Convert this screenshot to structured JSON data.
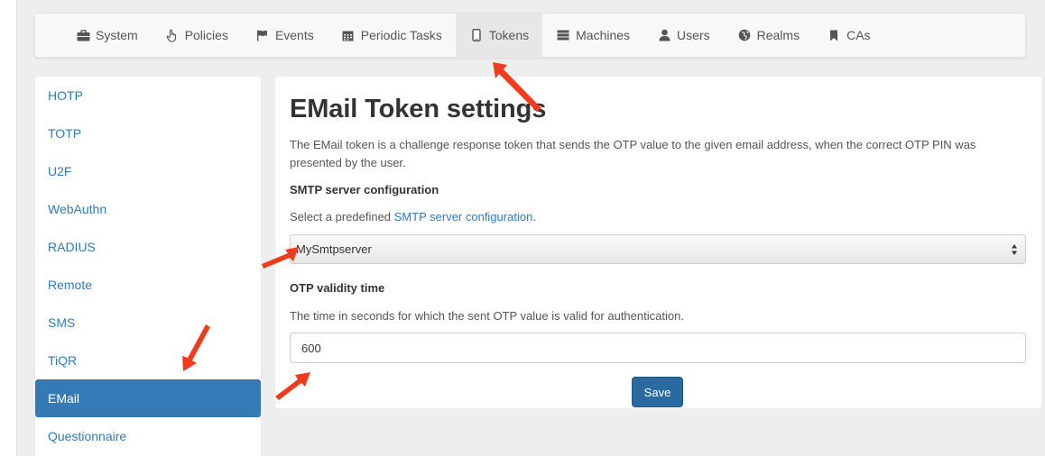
{
  "nav": {
    "items": [
      {
        "label": "System",
        "icon": "briefcase-icon"
      },
      {
        "label": "Policies",
        "icon": "hand-pointer-icon"
      },
      {
        "label": "Events",
        "icon": "flag-icon"
      },
      {
        "label": "Periodic Tasks",
        "icon": "calendar-icon"
      },
      {
        "label": "Tokens",
        "icon": "phone-icon",
        "active": true
      },
      {
        "label": "Machines",
        "icon": "server-icon"
      },
      {
        "label": "Users",
        "icon": "user-icon"
      },
      {
        "label": "Realms",
        "icon": "globe-icon"
      },
      {
        "label": "CAs",
        "icon": "bookmark-icon"
      }
    ]
  },
  "sidebar": {
    "items": [
      {
        "label": "HOTP"
      },
      {
        "label": "TOTP"
      },
      {
        "label": "U2F"
      },
      {
        "label": "WebAuthn"
      },
      {
        "label": "RADIUS"
      },
      {
        "label": "Remote"
      },
      {
        "label": "SMS"
      },
      {
        "label": "TiQR"
      },
      {
        "label": "EMail",
        "active": true
      },
      {
        "label": "Questionnaire"
      }
    ]
  },
  "main": {
    "title": "EMail Token settings",
    "description": "The EMail token is a challenge response token that sends the OTP value to the given email address, when the correct OTP PIN was presented by the user.",
    "smtp": {
      "label": "SMTP server configuration",
      "help_prefix": "Select a predefined ",
      "help_link": "SMTP server configuration",
      "help_suffix": ".",
      "selected": "MySmtpserver"
    },
    "validity": {
      "label": "OTP validity time",
      "help": "The time in seconds for which the sent OTP value is valid for authentication.",
      "value": "600"
    },
    "save_label": "Save"
  },
  "colors": {
    "accent": "#337ab7",
    "save_button": "#2b6aa0",
    "annotation_arrow": "#f03c1e"
  }
}
